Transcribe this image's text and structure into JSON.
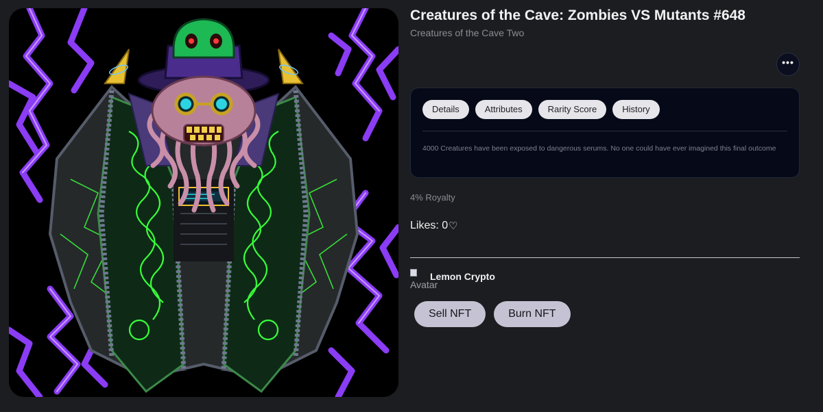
{
  "nft": {
    "title": "Creatures of the Cave: Zombies VS Mutants #648",
    "collection": "Creatures of the Cave Two",
    "image_alt": "Creature artwork"
  },
  "more_button": {
    "label": "•••",
    "icon": "more-horizontal-icon"
  },
  "panel": {
    "tabs": [
      {
        "label": "Details"
      },
      {
        "label": "Attributes"
      },
      {
        "label": "Rarity Score"
      },
      {
        "label": "History"
      }
    ],
    "description": "4000 Creatures have been exposed to dangerous serums. No one could have ever imagined this final outcome"
  },
  "royalty": "4% Royalty",
  "likes": {
    "label": "Likes: 0",
    "icon": "heart-icon",
    "glyph": "♡"
  },
  "owner": {
    "name": "Lemon Crypto",
    "avatar_alt": "Avatar"
  },
  "actions": {
    "sell_label": "Sell NFT",
    "burn_label": "Burn NFT"
  },
  "colors": {
    "background": "#1c1d20",
    "panel": "#050918",
    "tab": "#e6e6ea",
    "action_button": "#c5c3d3",
    "art_lightning": "#8b3cf5",
    "art_neon_green": "#39ff3a",
    "art_zombie_green": "#1db954"
  }
}
